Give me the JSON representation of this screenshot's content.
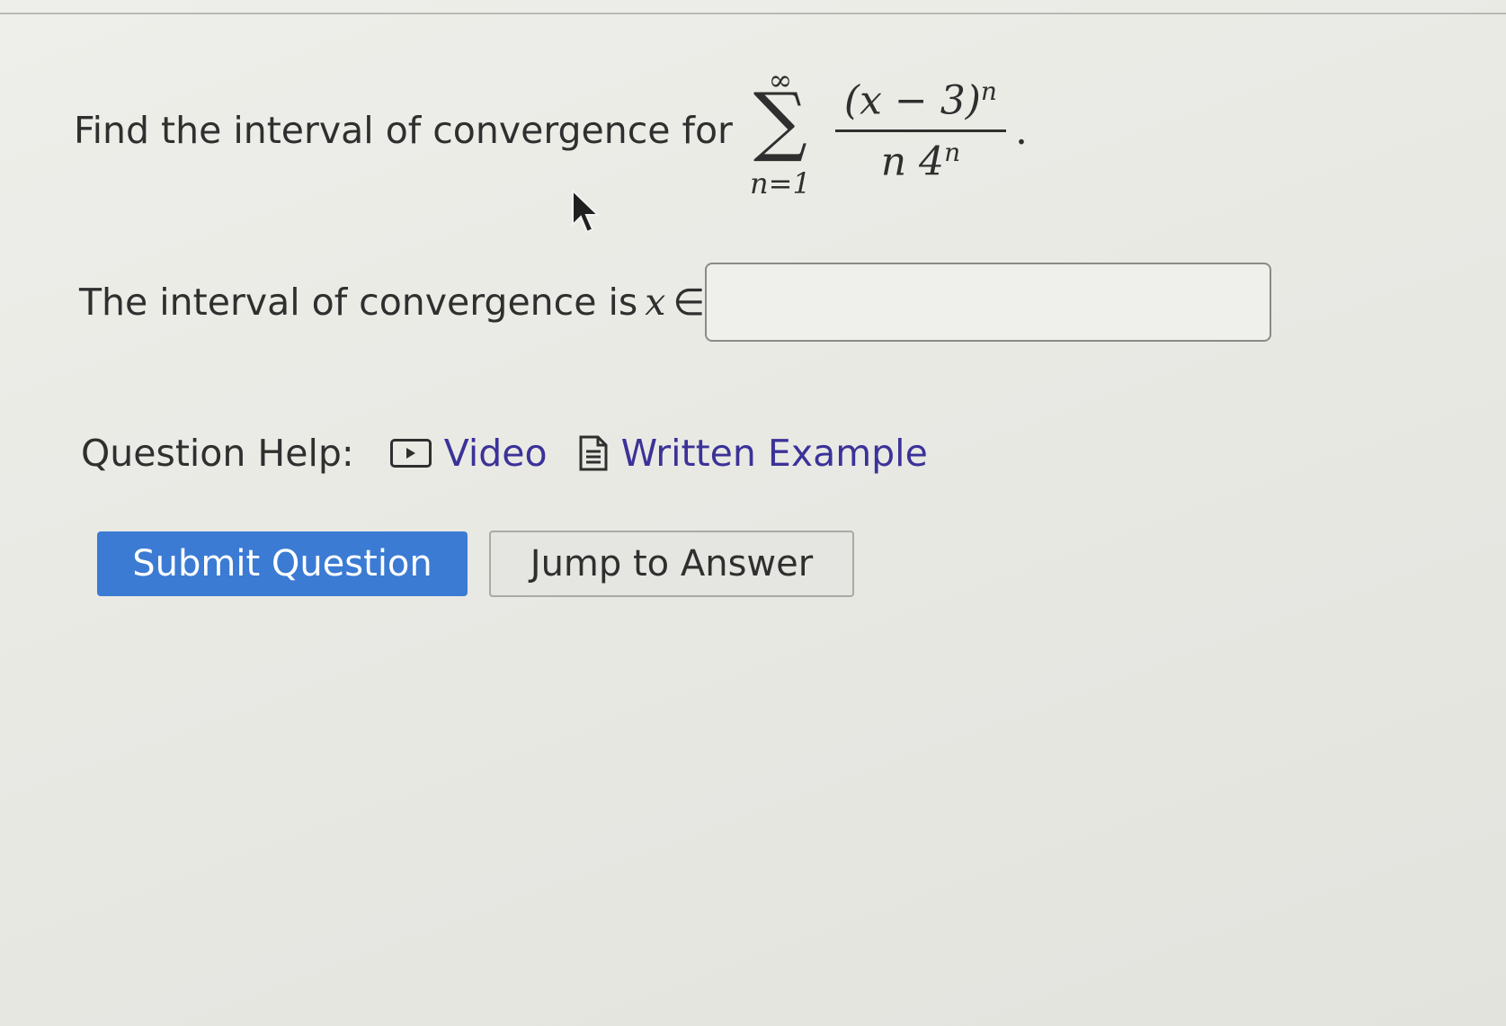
{
  "question": {
    "prompt": "Find the interval of convergence for",
    "sum_upper": "∞",
    "sum_symbol": "∑",
    "sum_lower": "n=1",
    "numerator_base": "(x − 3)",
    "numerator_exp": "n",
    "denominator_base": "n 4",
    "denominator_exp": "n",
    "period": "."
  },
  "answer": {
    "label": "The interval of convergence is",
    "variable": "x",
    "symbol": "∈",
    "value": ""
  },
  "help": {
    "label": "Question Help:",
    "video_label": "Video",
    "video_icon": "video-play-icon",
    "example_label": "Written Example",
    "example_icon": "document-icon",
    "link_color": "#3b3298"
  },
  "buttons": {
    "submit_label": "Submit Question",
    "submit_color": "#3b7bd4",
    "jump_label": "Jump to Answer"
  }
}
